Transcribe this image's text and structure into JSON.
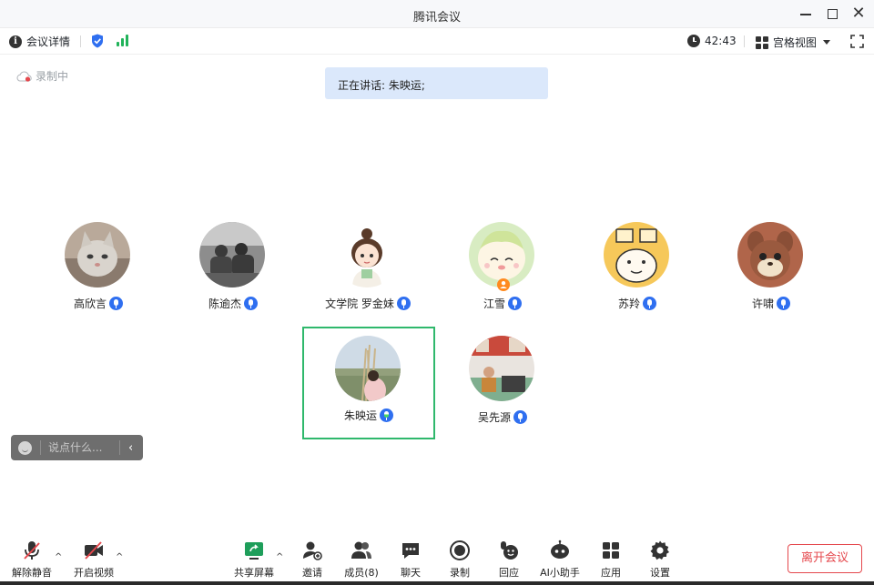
{
  "window": {
    "title": "腾讯会议",
    "close_glyph": "✕"
  },
  "infobar": {
    "details_label": "会议详情",
    "elapsed": "42:43",
    "view_label": "宫格视图"
  },
  "recording": {
    "label": "录制中"
  },
  "speaking_banner": {
    "text": "正在讲话: 朱映运;"
  },
  "participants": [
    {
      "name": "高欣言",
      "avatar": "cat-photo",
      "mic": "muted"
    },
    {
      "name": "陈逾杰",
      "avatar": "group-photo",
      "mic": "muted"
    },
    {
      "name": "文学院 罗金妹",
      "avatar": "cartoon-girl",
      "mic": "muted"
    },
    {
      "name": "江雪",
      "avatar": "cartoon-baby",
      "mic": "muted"
    },
    {
      "name": "苏羚",
      "avatar": "cartoon-cat",
      "mic": "muted"
    },
    {
      "name": "许啸",
      "avatar": "squirrel-plush",
      "mic": "muted"
    },
    {
      "name": "朱映运",
      "avatar": "reeds-photo",
      "mic": "speaking",
      "active": true
    },
    {
      "name": "吴先源",
      "avatar": "lecture-photo",
      "mic": "muted"
    }
  ],
  "chat": {
    "placeholder": "说点什么...",
    "collapse_glyph": "‹"
  },
  "toolbar": {
    "unmute": "解除静音",
    "start_video": "开启视频",
    "share": "共享屏幕",
    "invite": "邀请",
    "members": "成员(8)",
    "chat": "聊天",
    "record": "录制",
    "echo": "回应",
    "ai": "AI小助手",
    "apps": "应用",
    "settings": "设置",
    "leave": "离开会议",
    "caret_glyph": "^"
  },
  "colors": {
    "accent": "#2f6ff0",
    "active_border": "#2fb86c",
    "leave": "#e5484d",
    "signal": "#21b35a",
    "banner": "#dbe8fb"
  }
}
